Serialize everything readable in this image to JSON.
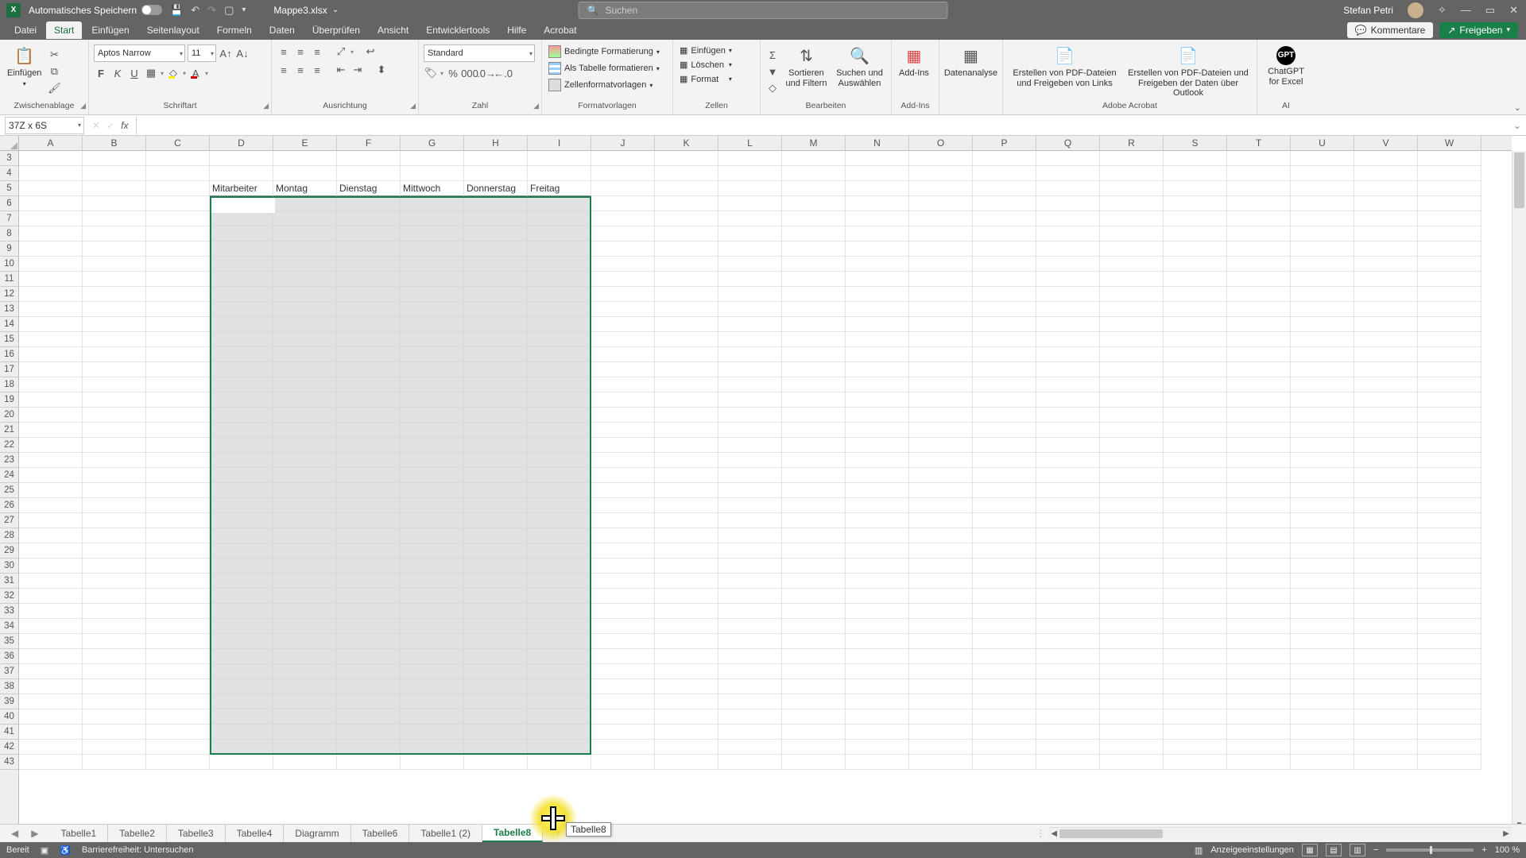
{
  "titlebar": {
    "autosave_label": "Automatisches Speichern",
    "filename": "Mappe3.xlsx",
    "search_placeholder": "Suchen",
    "username": "Stefan Petri"
  },
  "menu": {
    "items": [
      "Datei",
      "Start",
      "Einfügen",
      "Seitenlayout",
      "Formeln",
      "Daten",
      "Überprüfen",
      "Ansicht",
      "Entwicklertools",
      "Hilfe",
      "Acrobat"
    ],
    "active": "Start",
    "comments": "Kommentare",
    "share": "Freigeben"
  },
  "ribbon": {
    "clipboard": {
      "paste": "Einfügen",
      "label": "Zwischenablage"
    },
    "font": {
      "name": "Aptos Narrow",
      "size": "11",
      "label": "Schriftart"
    },
    "align": {
      "label": "Ausrichtung"
    },
    "number": {
      "format": "Standard",
      "label": "Zahl"
    },
    "styles": {
      "cond": "Bedingte Formatierung",
      "table": "Als Tabelle formatieren",
      "cellstyle": "Zellenformatvorlagen",
      "label": "Formatvorlagen"
    },
    "cells": {
      "insert": "Einfügen",
      "delete": "Löschen",
      "format": "Format",
      "label": "Zellen"
    },
    "editing": {
      "sort": "Sortieren und Filtern",
      "find": "Suchen und Auswählen",
      "label": "Bearbeiten"
    },
    "addins": {
      "addin": "Add-Ins",
      "label": "Add-Ins"
    },
    "analysis": {
      "btn": "Datenanalyse"
    },
    "acrobat": {
      "pdf1": "Erstellen von PDF-Dateien und Freigeben von Links",
      "pdf2": "Erstellen von PDF-Dateien und Freigeben der Daten über Outlook",
      "label": "Adobe Acrobat"
    },
    "ai": {
      "gpt": "ChatGPT for Excel",
      "label": "AI"
    }
  },
  "namebox": "37Z x 6S",
  "columns": [
    "A",
    "B",
    "C",
    "D",
    "E",
    "F",
    "G",
    "H",
    "I",
    "J",
    "K",
    "L",
    "M",
    "N",
    "O",
    "P",
    "Q",
    "R",
    "S",
    "T",
    "U",
    "V",
    "W"
  ],
  "first_row": 3,
  "headers": {
    "D": "Mitarbeiter",
    "E": "Montag",
    "F": "Dienstag",
    "G": "Mittwoch",
    "H": "Donnerstag",
    "I": "Freitag"
  },
  "header_row": 5,
  "dragtip": "Tabelle8",
  "sheet_tabs": [
    "Tabelle1",
    "Tabelle2",
    "Tabelle3",
    "Tabelle4",
    "Diagramm",
    "Tabelle6",
    "Tabelle1 (2)",
    "Tabelle8"
  ],
  "active_sheet": "Tabelle8",
  "status": {
    "ready": "Bereit",
    "access": "Barrierefreiheit: Untersuchen",
    "display": "Anzeigeeinstellungen",
    "zoom": "100 %"
  }
}
